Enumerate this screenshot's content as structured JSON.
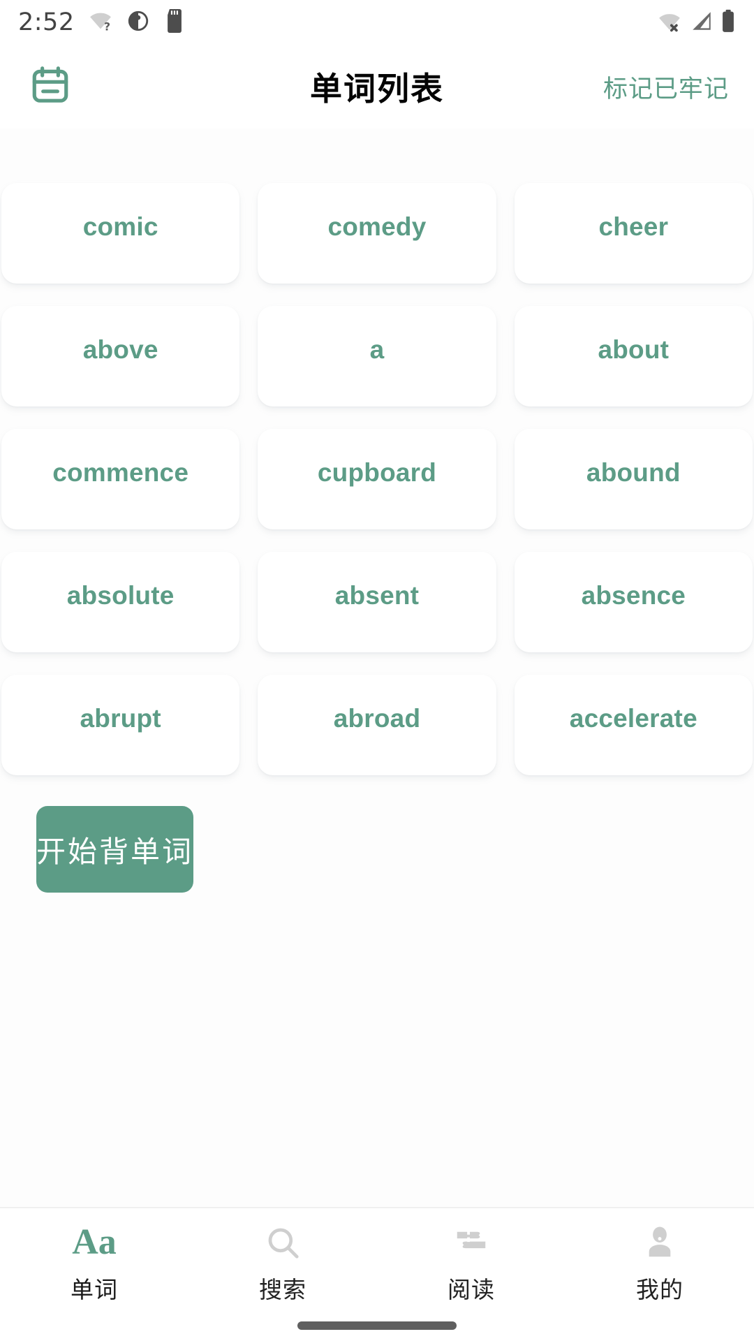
{
  "status_bar": {
    "time": "2:52",
    "left_icons": [
      "wifi-question-icon",
      "contrast-circle-icon",
      "sd-card-icon"
    ],
    "right_icons": [
      "wifi-off-icon",
      "cellular-signal-icon",
      "battery-full-icon"
    ]
  },
  "app_bar": {
    "calendar_icon": "calendar-icon",
    "title": "单词列表",
    "mark_action_label": "标记已牢记"
  },
  "colors": {
    "accent": "#5c9c86",
    "card_background": "#ffffff",
    "page_background": "#fdfdfd",
    "title_text": "#040404",
    "nav_inactive_icon": "#cfcfcf"
  },
  "word_grid": {
    "columns": 3,
    "words": [
      "comic",
      "comedy",
      "cheer",
      "above",
      "a",
      "about",
      "commence",
      "cupboard",
      "abound",
      "absolute",
      "absent",
      "absence",
      "abrupt",
      "abroad",
      "accelerate"
    ]
  },
  "start_button": {
    "label": "开始背单词"
  },
  "bottom_nav": {
    "items": [
      {
        "label": "单词",
        "icon": "aa-text-icon",
        "icon_glyph": "Aa",
        "active": true
      },
      {
        "label": "搜索",
        "icon": "search-icon",
        "active": false
      },
      {
        "label": "阅读",
        "icon": "books-stack-icon",
        "active": false
      },
      {
        "label": "我的",
        "icon": "person-icon",
        "active": false
      }
    ]
  }
}
